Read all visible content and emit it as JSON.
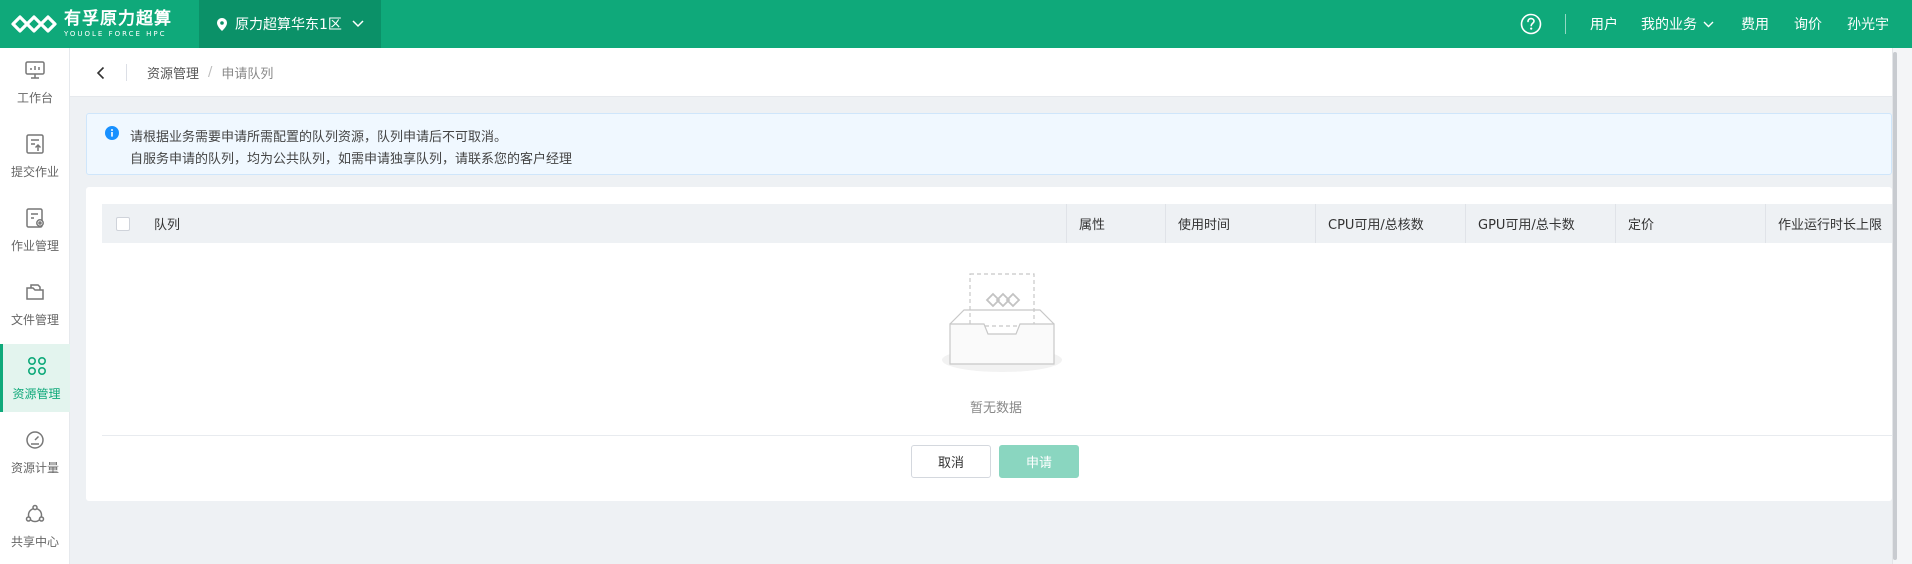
{
  "header": {
    "logo_cn": "有孚原力超算",
    "logo_en": "YOUOLE FORCE HPC",
    "region": "原力超算华东1区",
    "nav": {
      "users": "用户",
      "my_business": "我的业务",
      "fees": "费用",
      "inquiry": "询价",
      "user_name": "孙光宇"
    }
  },
  "sidebar": {
    "items": [
      {
        "label": "工作台",
        "icon": "monitor-icon"
      },
      {
        "label": "提交作业",
        "icon": "submit-job-icon"
      },
      {
        "label": "作业管理",
        "icon": "job-manage-icon"
      },
      {
        "label": "文件管理",
        "icon": "folder-icon"
      },
      {
        "label": "资源管理",
        "icon": "resource-grid-icon",
        "active": true
      },
      {
        "label": "资源计量",
        "icon": "gauge-icon"
      },
      {
        "label": "共享中心",
        "icon": "share-icon"
      }
    ]
  },
  "breadcrumb": {
    "parent": "资源管理",
    "separator": "/",
    "current": "申请队列"
  },
  "notice": {
    "line1": "请根据业务需要申请所需配置的队列资源，队列申请后不可取消。",
    "line2": "自服务申请的队列，均为公共队列，如需申请独享队列，请联系您的客户经理"
  },
  "table": {
    "columns": [
      "队列",
      "属性",
      "使用时间",
      "CPU可用/总核数",
      "GPU可用/总卡数",
      "定价",
      "作业运行时长上限"
    ],
    "rows": [],
    "empty_text": "暂无数据"
  },
  "actions": {
    "cancel": "取消",
    "apply": "申请"
  },
  "colors": {
    "brand": "#0fa97a",
    "region_bg": "#0b9168",
    "apply_disabled": "#8ad6c0",
    "notice_bg": "#f0f8ff",
    "info": "#1890ff"
  }
}
